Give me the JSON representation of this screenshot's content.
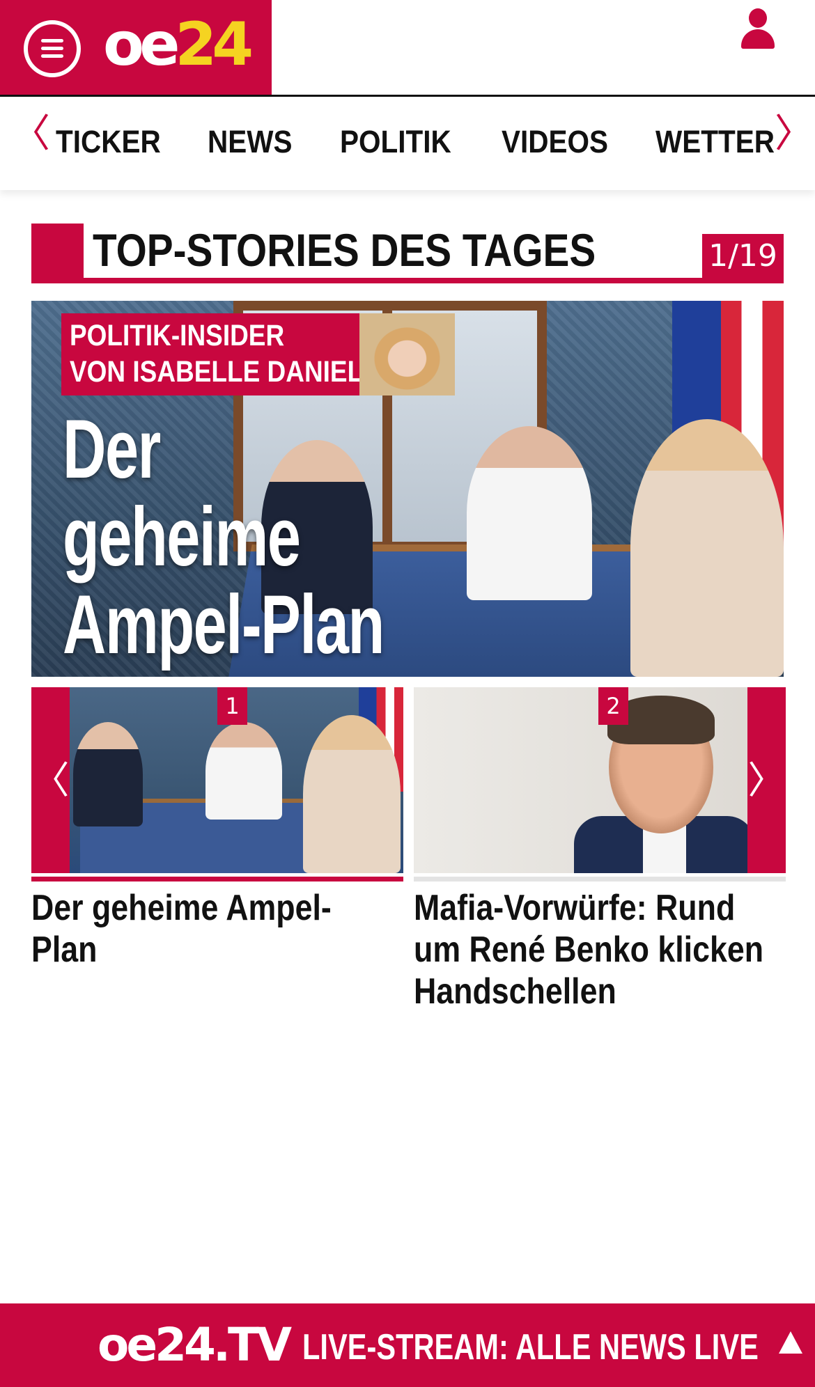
{
  "header": {
    "logo_oe": "oe",
    "logo_num": "24",
    "menu_icon": "hamburger-menu-icon",
    "user_icon": "user-icon"
  },
  "nav": {
    "items": [
      {
        "label": "TICKER"
      },
      {
        "label": "NEWS"
      },
      {
        "label": "POLITIK"
      },
      {
        "label": "VIDEOS"
      },
      {
        "label": "WETTER"
      }
    ],
    "prev_icon": "chevron-left-icon",
    "next_icon": "chevron-right-icon",
    "prev_glyph": "〈",
    "next_glyph": "〉"
  },
  "section": {
    "title": "TOP-STORIES DES TAGES",
    "counter": "1/19"
  },
  "hero": {
    "kicker_line1": "POLITIK-INSIDER",
    "kicker_line2": "VON ISABELLE DANIEL",
    "headline_line1": "Der",
    "headline_line2": "geheime",
    "headline_line3": "Ampel-Plan"
  },
  "teasers": [
    {
      "index": "1",
      "title": "Der geheime Ampel-Plan"
    },
    {
      "index": "2",
      "title": "Mafia-Vorwürfe: Rund um René Benko klicken Handschellen"
    }
  ],
  "slider": {
    "prev_glyph": "〈",
    "next_glyph": "〉"
  },
  "live_bar": {
    "logo": "oe24.TV",
    "text": "LIVE-STREAM:  ALLE NEWS LIVE",
    "up_icon": "scroll-top-icon"
  },
  "colors": {
    "brand_red": "#c8073f",
    "logo_yellow": "#f5d321"
  }
}
